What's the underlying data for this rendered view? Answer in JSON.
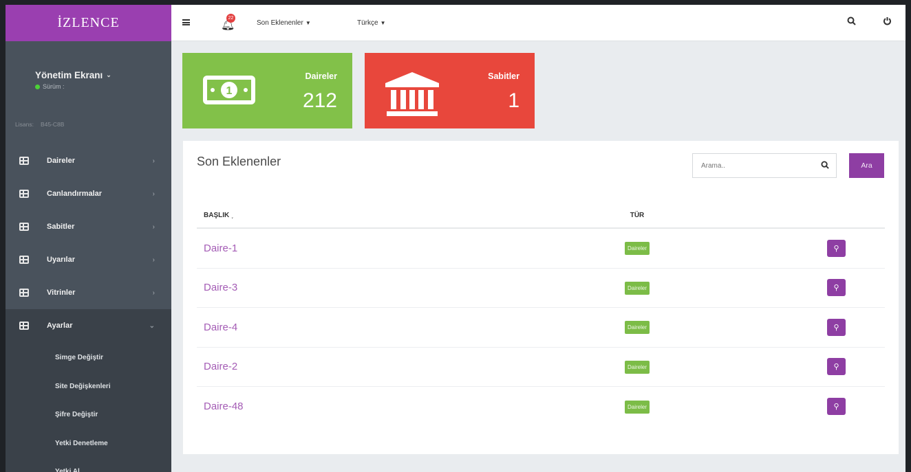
{
  "sidebar": {
    "brand": "İZLENCE",
    "profile_name": "Yönetim Ekranı",
    "version_label": "Sürüm :",
    "license_label": "Lisans:",
    "license_value": "B45-C8B",
    "items": [
      {
        "label": "Daireler",
        "icon": "grid-icon"
      },
      {
        "label": "Canlandırmalar",
        "icon": "grid-icon"
      },
      {
        "label": "Sabitler",
        "icon": "grid-icon"
      },
      {
        "label": "Uyarılar",
        "icon": "grid-icon"
      },
      {
        "label": "Vitrinler",
        "icon": "grid-icon"
      },
      {
        "label": "Ayarlar",
        "icon": "grid-icon",
        "expanded": true
      }
    ],
    "submenu": [
      {
        "label": "Simge Değiştir"
      },
      {
        "label": "Site Değişkenleri"
      },
      {
        "label": "Şifre Değiştir"
      },
      {
        "label": "Yetki Denetleme"
      },
      {
        "label": "Yetki Al"
      }
    ]
  },
  "topbar": {
    "menu_icon": "hamburger-icon",
    "notification_icon": "bell-icon",
    "notification_count": "22",
    "recent_label": "Son Eklenenler",
    "language_label": "Türkçe",
    "search_icon": "search-icon",
    "power_icon": "power-icon"
  },
  "cards": [
    {
      "label": "Daireler",
      "value": "212",
      "color": "#82c149",
      "icon": "money-icon"
    },
    {
      "label": "Sabitler",
      "value": "1",
      "color": "#e8473c",
      "icon": "bank-icon"
    }
  ],
  "panel": {
    "title": "Son Eklenenler",
    "search_placeholder": "Arama..",
    "search_button": "Ara",
    "columns": {
      "title": "BAŞLIK",
      "type": "TÜR"
    },
    "rows": [
      {
        "title": "Daire-1",
        "type": "Daireler"
      },
      {
        "title": "Daire-3",
        "type": "Daireler"
      },
      {
        "title": "Daire-4",
        "type": "Daireler"
      },
      {
        "title": "Daire-2",
        "type": "Daireler"
      },
      {
        "title": "Daire-48",
        "type": "Daireler"
      }
    ]
  },
  "colors": {
    "accent": "#8e3ea3",
    "brand_bg": "#9a3fb0",
    "sidebar_bg": "#49525c",
    "success": "#82c149",
    "danger": "#e8473c"
  }
}
